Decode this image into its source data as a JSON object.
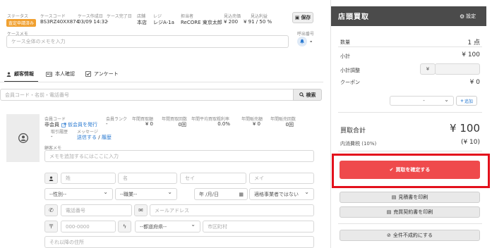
{
  "header": {
    "status_label": "ステータス",
    "status_value": "査定申請済み",
    "case_code_label": "ケースコード",
    "case_code_value": "BS3RZ40XX874",
    "created_label": "ケース作成日",
    "created_value": "03/09 14:32",
    "completed_label": "ケース完了日",
    "completed_value": "-",
    "store_label": "店舗",
    "store_value": "本店",
    "register_label": "レジ",
    "register_value": "レジA-1a",
    "staff_label": "担当者",
    "staff_value": "ReCORE 東京太郎",
    "est_sales_label": "見込売価",
    "est_sales_value": "¥ 200",
    "est_profit_label": "見込利益",
    "est_profit_value": "¥ 91 / 50 %",
    "save_label": "保存"
  },
  "memo": {
    "label": "ケースメモ",
    "placeholder": "ケース全体のメモを入力",
    "call_label": "呼出番号",
    "call_value": "-"
  },
  "tabs": [
    {
      "label": "顧客情報",
      "icon": "user-icon"
    },
    {
      "label": "本人確認",
      "icon": "id-card-icon"
    },
    {
      "label": "アンケート",
      "icon": "checkbox-icon"
    }
  ],
  "search": {
    "placeholder": "会員コード・名前・電話番号",
    "button_label": "検索"
  },
  "customer": {
    "member_code_label": "会員コード",
    "member_code_value": "非会員",
    "provisional_link": "仮会員を発行",
    "rank_label": "会員ランク",
    "rank_value": "-",
    "annual_purchase_label": "年間買取額",
    "annual_purchase_value": "¥ 0",
    "annual_count_label": "年間買取回数",
    "annual_count_value": "0回",
    "avg_profit_label": "年間平均買取粗利率",
    "avg_profit_value": "0.0%",
    "annual_sales_label": "年間販売額",
    "annual_sales_value": "¥ 0",
    "annual_sales_count_label": "年間販売回数",
    "annual_sales_count_value": "0回",
    "history_label": "取引履歴",
    "history_value": "-",
    "message_label": "メッセージ",
    "send_link": "送信する",
    "history_link": "履歴",
    "customer_memo_label": "顧客メモ",
    "customer_memo_placeholder": "メモを追加するにはここに入力"
  },
  "form": {
    "last_name": "姓",
    "first_name": "名",
    "last_kana": "セイ",
    "first_kana": "メイ",
    "gender": "--性別--",
    "occupation": "--職業--",
    "date": "年 /月/日",
    "invoice": "適格事業者ではない",
    "phone": "電話番号",
    "email": "メールアドレス",
    "postal": "000-0000",
    "prefecture": "--都道府県--",
    "city": "市区町村",
    "address": "それ以降の住所"
  },
  "side": {
    "title": "店頭買取",
    "settings_label": "設定",
    "qty_label": "数量",
    "qty_value": "1 点",
    "subtotal_label": "小計",
    "subtotal_value": "¥ 100",
    "adjust_label": "小計調整",
    "adjust_prefix": "¥",
    "coupon_label": "クーポン",
    "coupon_value": "¥ 0",
    "coupon_select": "-",
    "add_label": "追加",
    "total_label": "買取合計",
    "total_value": "¥ 100",
    "tax_label": "内消費税 (10%)",
    "tax_value": "(¥ 10)",
    "confirm_label": "買取を確定する",
    "estimate_label": "見積書を印刷",
    "contract_label": "売買契約書を印刷",
    "cancel_label": "全件不成約にする"
  },
  "colors": {
    "accent_red": "#ef4a4c",
    "highlight_red": "#e3101c",
    "panel_dark": "#4b4b4b",
    "link_blue": "#2a7ad1",
    "status_orange": "#f0a030"
  }
}
